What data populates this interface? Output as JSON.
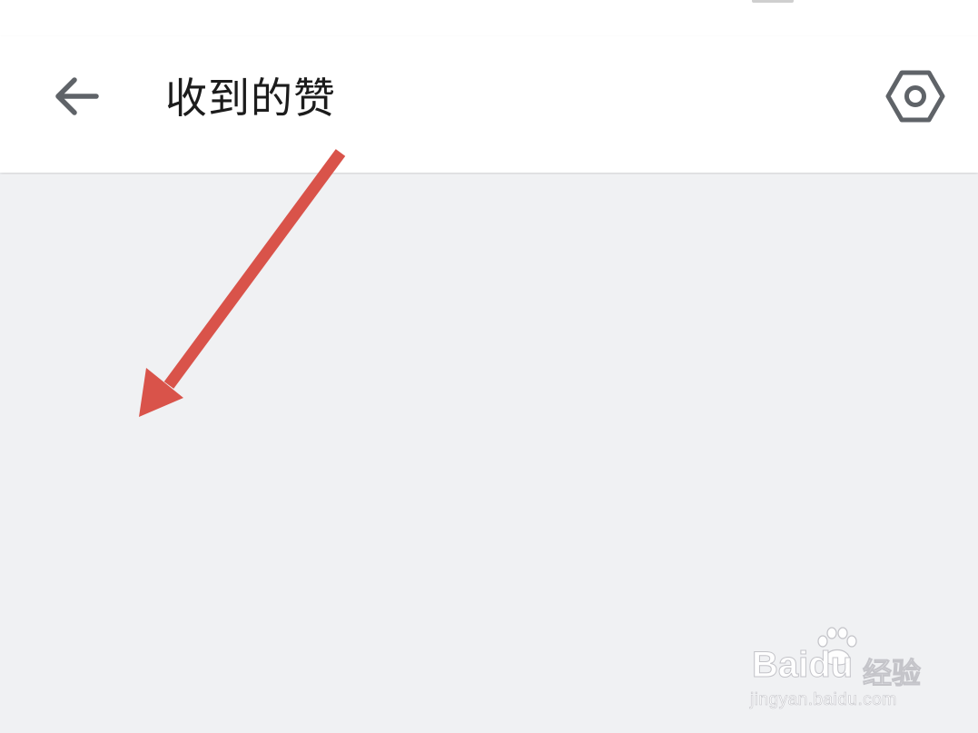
{
  "header": {
    "title": "收到的赞",
    "back_icon": "arrow-left-icon",
    "settings_icon": "hexagon-settings-icon"
  },
  "content": {
    "items": []
  },
  "annotation": {
    "arrow_color": "#d9534a"
  },
  "watermark": {
    "logo_text": "Baidu",
    "logo_cn": "经验",
    "url": "jingyan.baidu.com"
  },
  "colors": {
    "background": "#f0f1f3",
    "app_bar": "#ffffff",
    "icon": "#5f6368",
    "title": "#1c1c1c"
  }
}
